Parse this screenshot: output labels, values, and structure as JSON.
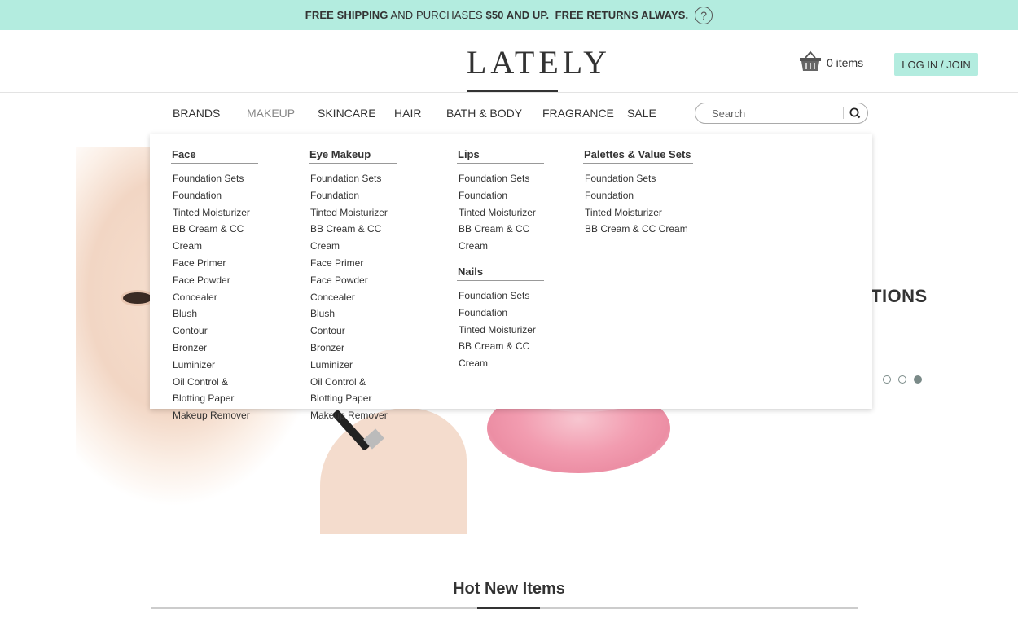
{
  "promo": {
    "part1": "FREE SHIPPING",
    "part2": " AND PURCHASES ",
    "part3": "$50 AND UP.",
    "part4": "  FREE RETURNS ALWAYS.",
    "help": "?"
  },
  "header": {
    "logo": "LATELY",
    "cart_label": "0 items",
    "login_label": "LOG IN / JOIN"
  },
  "nav": {
    "items": [
      "BRANDS",
      "MAKEUP",
      "SKINCARE",
      "HAIR",
      "BATH & BODY",
      "FRAGRANCE",
      "SALE"
    ],
    "active": "MAKEUP"
  },
  "search": {
    "placeholder": "Search"
  },
  "mega_menu": {
    "face": {
      "title": "Face",
      "items": [
        "Foundation Sets",
        "Foundation",
        "Tinted Moisturizer",
        "BB Cream & CC Cream",
        "Face Primer",
        "Face Powder",
        "Concealer",
        "Blush",
        "Contour",
        "Bronzer",
        "Luminizer",
        "Oil Control & Blotting Paper",
        "Makeup Remover"
      ]
    },
    "eye": {
      "title": "Eye Makeup",
      "items": [
        "Foundation Sets",
        "Foundation",
        "Tinted Moisturizer",
        "BB Cream & CC Cream",
        "Face Primer",
        "Face Powder",
        "Concealer",
        "Blush",
        "Contour",
        "Bronzer",
        "Luminizer",
        "Oil Control & Blotting Paper",
        "Makeup Remover"
      ]
    },
    "lips": {
      "title": "Lips",
      "items": [
        "Foundation Sets",
        "Foundation",
        "Tinted Moisturizer",
        "BB Cream & CC Cream"
      ]
    },
    "nails": {
      "title": "Nails",
      "items": [
        "Foundation Sets",
        "Foundation",
        "Tinted Moisturizer",
        "BB Cream & CC Cream"
      ]
    },
    "palettes": {
      "title": "Palettes & Value Sets",
      "items": [
        "Foundation Sets",
        "Foundation",
        "Tinted Moisturizer",
        "BB Cream & CC Cream"
      ]
    }
  },
  "hero": {
    "text": "TIONS",
    "slides": 3,
    "active_slide": 3
  },
  "section": {
    "title": "Hot New Items"
  },
  "colors": {
    "promo_bg": "#b3ecdf",
    "login_bg": "#b3ecdf",
    "text": "#333333"
  }
}
